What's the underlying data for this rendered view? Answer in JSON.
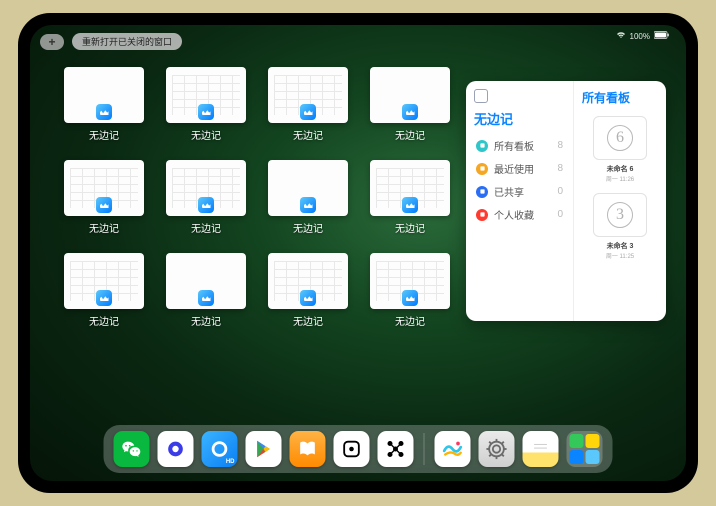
{
  "status": {
    "battery": "100%"
  },
  "topbar": {
    "plus": "+",
    "reopen": "重新打开已关闭的窗口"
  },
  "apps": [
    {
      "label": "无边记",
      "variant": "plain"
    },
    {
      "label": "无边记",
      "variant": "grid"
    },
    {
      "label": "无边记",
      "variant": "grid"
    },
    {
      "label": "无边记",
      "variant": "plain"
    },
    {
      "label": "无边记",
      "variant": "grid"
    },
    {
      "label": "无边记",
      "variant": "grid"
    },
    {
      "label": "无边记",
      "variant": "plain"
    },
    {
      "label": "无边记",
      "variant": "grid"
    },
    {
      "label": "无边记",
      "variant": "grid"
    },
    {
      "label": "无边记",
      "variant": "plain"
    },
    {
      "label": "无边记",
      "variant": "grid"
    },
    {
      "label": "无边记",
      "variant": "grid"
    }
  ],
  "panel": {
    "title": "无边记",
    "right_title": "所有看板",
    "items": [
      {
        "label": "所有看板",
        "count": 8,
        "color": "#2fc6c9"
      },
      {
        "label": "最近使用",
        "count": 8,
        "color": "#f5a623"
      },
      {
        "label": "已共享",
        "count": 0,
        "color": "#2b6ef6"
      },
      {
        "label": "个人收藏",
        "count": 0,
        "color": "#ff3b30"
      }
    ],
    "boards": [
      {
        "name": "未命名 6",
        "date": "周一 11:26",
        "glyph": "6"
      },
      {
        "name": "未命名 3",
        "date": "周一 11:25",
        "glyph": "3"
      }
    ]
  },
  "dock": {
    "icons": [
      {
        "name": "wechat",
        "bg": "#09b83e"
      },
      {
        "name": "quark",
        "bg": "#ffffff"
      },
      {
        "name": "qq-browser",
        "bg": "#2196f3"
      },
      {
        "name": "playstore",
        "bg": "#ffffff"
      },
      {
        "name": "books",
        "bg": "#ff9500"
      },
      {
        "name": "dice",
        "bg": "#ffffff"
      },
      {
        "name": "mesh",
        "bg": "#ffffff"
      }
    ],
    "recent": [
      {
        "name": "freeform",
        "bg": "#ffffff"
      },
      {
        "name": "settings",
        "bg": "#e0e0e0"
      },
      {
        "name": "stickies",
        "bg": "#ffffff"
      }
    ]
  }
}
